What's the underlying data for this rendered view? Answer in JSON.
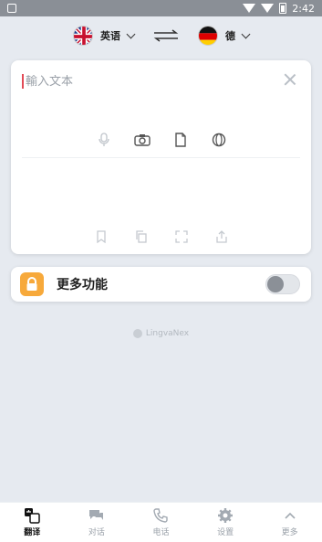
{
  "status_bar": {
    "time": "2:42"
  },
  "language_bar": {
    "source_language": "英语",
    "target_language": "德"
  },
  "translator": {
    "input_placeholder": "輸入文本"
  },
  "feature": {
    "label": "更多功能",
    "toggle_on": false
  },
  "brand": {
    "name": "LingvaNex"
  },
  "bottom_nav": {
    "items": [
      {
        "label": "翻译",
        "icon": "translate-icon",
        "active": true
      },
      {
        "label": "对话",
        "icon": "chat-icon",
        "active": false
      },
      {
        "label": "电话",
        "icon": "phone-icon",
        "active": false
      },
      {
        "label": "设置",
        "icon": "gear-icon",
        "active": false
      },
      {
        "label": "更多",
        "icon": "chevron-up-icon",
        "active": false
      }
    ]
  },
  "colors": {
    "background": "#e6eaf0",
    "accent_lock": "#f7a93b",
    "cursor": "#e24b57"
  }
}
